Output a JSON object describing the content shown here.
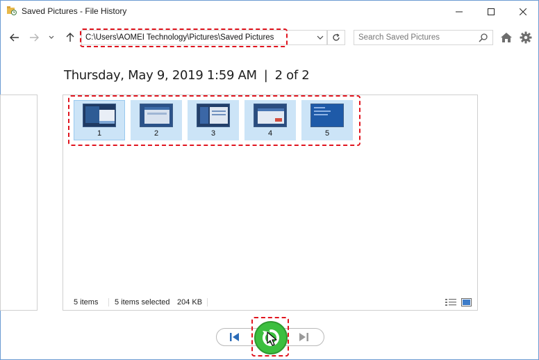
{
  "window": {
    "title": "Saved Pictures - File History"
  },
  "navbar": {
    "address": "C:\\Users\\AOMEI Technology\\Pictures\\Saved Pictures",
    "search_placeholder": "Search Saved Pictures"
  },
  "heading": {
    "date": "Thursday, May 9, 2019 1:59 AM",
    "separator": "|",
    "version": "2 of 2"
  },
  "items": [
    {
      "label": "1"
    },
    {
      "label": "2"
    },
    {
      "label": "3"
    },
    {
      "label": "4"
    },
    {
      "label": "5"
    }
  ],
  "status": {
    "count": "5 items",
    "selected": "5 items selected",
    "size": "204 KB"
  },
  "colors": {
    "accent_highlight": "#e0141e",
    "restore_green": "#3cbf3f",
    "selection": "#cce4f7"
  },
  "icons": {
    "back": "arrow-left-icon",
    "forward": "arrow-right-icon",
    "recent": "chevron-down-icon",
    "up": "arrow-up-icon",
    "refresh": "refresh-icon",
    "search": "search-icon",
    "home": "home-icon",
    "settings": "gear-icon",
    "previous": "skip-previous-icon",
    "restore": "restore-icon",
    "next": "skip-next-icon"
  }
}
